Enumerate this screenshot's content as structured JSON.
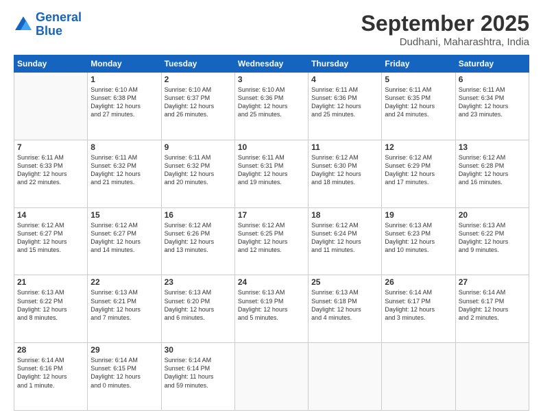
{
  "logo": {
    "line1": "General",
    "line2": "Blue"
  },
  "title": "September 2025",
  "location": "Dudhani, Maharashtra, India",
  "days_header": [
    "Sunday",
    "Monday",
    "Tuesday",
    "Wednesday",
    "Thursday",
    "Friday",
    "Saturday"
  ],
  "weeks": [
    [
      {
        "day": "",
        "info": ""
      },
      {
        "day": "1",
        "info": "Sunrise: 6:10 AM\nSunset: 6:38 PM\nDaylight: 12 hours\nand 27 minutes."
      },
      {
        "day": "2",
        "info": "Sunrise: 6:10 AM\nSunset: 6:37 PM\nDaylight: 12 hours\nand 26 minutes."
      },
      {
        "day": "3",
        "info": "Sunrise: 6:10 AM\nSunset: 6:36 PM\nDaylight: 12 hours\nand 25 minutes."
      },
      {
        "day": "4",
        "info": "Sunrise: 6:11 AM\nSunset: 6:36 PM\nDaylight: 12 hours\nand 25 minutes."
      },
      {
        "day": "5",
        "info": "Sunrise: 6:11 AM\nSunset: 6:35 PM\nDaylight: 12 hours\nand 24 minutes."
      },
      {
        "day": "6",
        "info": "Sunrise: 6:11 AM\nSunset: 6:34 PM\nDaylight: 12 hours\nand 23 minutes."
      }
    ],
    [
      {
        "day": "7",
        "info": "Sunrise: 6:11 AM\nSunset: 6:33 PM\nDaylight: 12 hours\nand 22 minutes."
      },
      {
        "day": "8",
        "info": "Sunrise: 6:11 AM\nSunset: 6:32 PM\nDaylight: 12 hours\nand 21 minutes."
      },
      {
        "day": "9",
        "info": "Sunrise: 6:11 AM\nSunset: 6:32 PM\nDaylight: 12 hours\nand 20 minutes."
      },
      {
        "day": "10",
        "info": "Sunrise: 6:11 AM\nSunset: 6:31 PM\nDaylight: 12 hours\nand 19 minutes."
      },
      {
        "day": "11",
        "info": "Sunrise: 6:12 AM\nSunset: 6:30 PM\nDaylight: 12 hours\nand 18 minutes."
      },
      {
        "day": "12",
        "info": "Sunrise: 6:12 AM\nSunset: 6:29 PM\nDaylight: 12 hours\nand 17 minutes."
      },
      {
        "day": "13",
        "info": "Sunrise: 6:12 AM\nSunset: 6:28 PM\nDaylight: 12 hours\nand 16 minutes."
      }
    ],
    [
      {
        "day": "14",
        "info": "Sunrise: 6:12 AM\nSunset: 6:27 PM\nDaylight: 12 hours\nand 15 minutes."
      },
      {
        "day": "15",
        "info": "Sunrise: 6:12 AM\nSunset: 6:27 PM\nDaylight: 12 hours\nand 14 minutes."
      },
      {
        "day": "16",
        "info": "Sunrise: 6:12 AM\nSunset: 6:26 PM\nDaylight: 12 hours\nand 13 minutes."
      },
      {
        "day": "17",
        "info": "Sunrise: 6:12 AM\nSunset: 6:25 PM\nDaylight: 12 hours\nand 12 minutes."
      },
      {
        "day": "18",
        "info": "Sunrise: 6:12 AM\nSunset: 6:24 PM\nDaylight: 12 hours\nand 11 minutes."
      },
      {
        "day": "19",
        "info": "Sunrise: 6:13 AM\nSunset: 6:23 PM\nDaylight: 12 hours\nand 10 minutes."
      },
      {
        "day": "20",
        "info": "Sunrise: 6:13 AM\nSunset: 6:22 PM\nDaylight: 12 hours\nand 9 minutes."
      }
    ],
    [
      {
        "day": "21",
        "info": "Sunrise: 6:13 AM\nSunset: 6:22 PM\nDaylight: 12 hours\nand 8 minutes."
      },
      {
        "day": "22",
        "info": "Sunrise: 6:13 AM\nSunset: 6:21 PM\nDaylight: 12 hours\nand 7 minutes."
      },
      {
        "day": "23",
        "info": "Sunrise: 6:13 AM\nSunset: 6:20 PM\nDaylight: 12 hours\nand 6 minutes."
      },
      {
        "day": "24",
        "info": "Sunrise: 6:13 AM\nSunset: 6:19 PM\nDaylight: 12 hours\nand 5 minutes."
      },
      {
        "day": "25",
        "info": "Sunrise: 6:13 AM\nSunset: 6:18 PM\nDaylight: 12 hours\nand 4 minutes."
      },
      {
        "day": "26",
        "info": "Sunrise: 6:14 AM\nSunset: 6:17 PM\nDaylight: 12 hours\nand 3 minutes."
      },
      {
        "day": "27",
        "info": "Sunrise: 6:14 AM\nSunset: 6:17 PM\nDaylight: 12 hours\nand 2 minutes."
      }
    ],
    [
      {
        "day": "28",
        "info": "Sunrise: 6:14 AM\nSunset: 6:16 PM\nDaylight: 12 hours\nand 1 minute."
      },
      {
        "day": "29",
        "info": "Sunrise: 6:14 AM\nSunset: 6:15 PM\nDaylight: 12 hours\nand 0 minutes."
      },
      {
        "day": "30",
        "info": "Sunrise: 6:14 AM\nSunset: 6:14 PM\nDaylight: 11 hours\nand 59 minutes."
      },
      {
        "day": "",
        "info": ""
      },
      {
        "day": "",
        "info": ""
      },
      {
        "day": "",
        "info": ""
      },
      {
        "day": "",
        "info": ""
      }
    ]
  ]
}
